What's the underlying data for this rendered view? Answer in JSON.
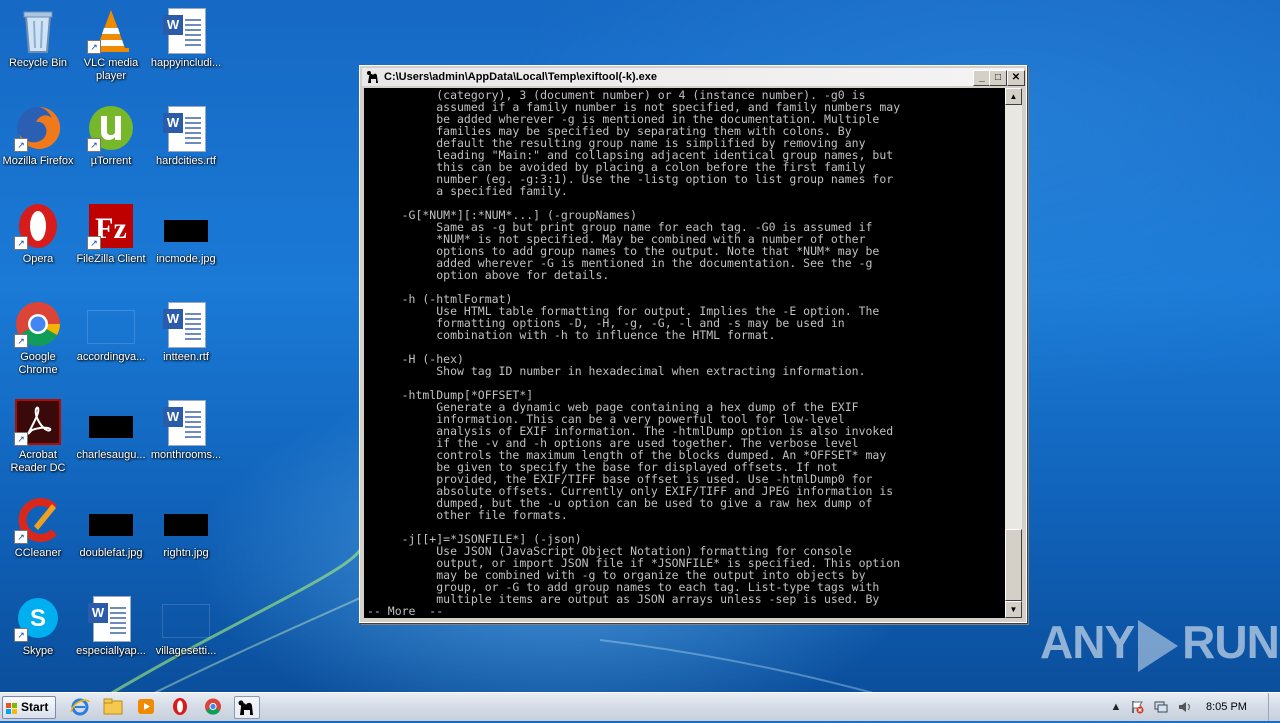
{
  "desktop": {
    "icons": [
      {
        "label": "Recycle Bin"
      },
      {
        "label": "VLC media player"
      },
      {
        "label": "happyincludi..."
      },
      {
        "label": "Mozilla Firefox"
      },
      {
        "label": "µTorrent"
      },
      {
        "label": "hardcities.rtf"
      },
      {
        "label": "Opera"
      },
      {
        "label": "FileZilla Client"
      },
      {
        "label": "incmode.jpg"
      },
      {
        "label": "Google Chrome"
      },
      {
        "label": "accordingva..."
      },
      {
        "label": "intteen.rtf"
      },
      {
        "label": "Acrobat Reader DC"
      },
      {
        "label": "charlesaugu..."
      },
      {
        "label": "monthrooms..."
      },
      {
        "label": "CCleaner"
      },
      {
        "label": "doublefat.jpg"
      },
      {
        "label": "rightn.jpg"
      },
      {
        "label": "Skype"
      },
      {
        "label": "especiallyap..."
      },
      {
        "label": "villagesetti..."
      }
    ]
  },
  "console_window": {
    "title": "C:\\Users\\admin\\AppData\\Local\\Temp\\exiftool(-k).exe",
    "lines": [
      "          (category), 3 (document number) or 4 (instance number). -g0 is",
      "          assumed if a family number is not specified, and family numbers may",
      "          be added wherever -g is mentioned in the documentation. Multiple",
      "          families may be specified by separating them with colons. By",
      "          default the resulting group name is simplified by removing any",
      "          leading \"Main:\" and collapsing adjacent identical group names, but",
      "          this can be avoided by placing a colon before the first family",
      "          number (eg. -g:3:1). Use the -listg option to list group names for",
      "          a specified family.",
      "",
      "     -G[*NUM*][:*NUM*...] (-groupNames)",
      "          Same as -g but print group name for each tag. -G0 is assumed if",
      "          *NUM* is not specified. May be combined with a number of other",
      "          options to add group names to the output. Note that *NUM* may be",
      "          added wherever -G is mentioned in the documentation. See the -g",
      "          option above for details.",
      "",
      "     -h (-htmlFormat)",
      "          Use HTML table formatting for output. Implies the -E option. The",
      "          formatting options -D, -H, -g, -G, -l and -s may be used in",
      "          combination with -h to influence the HTML format.",
      "",
      "     -H (-hex)",
      "          Show tag ID number in hexadecimal when extracting information.",
      "",
      "     -htmlDump[*OFFSET*]",
      "          Generate a dynamic web page containing a hex dump of the EXIF",
      "          information. This can be a very powerful tool for low-level",
      "          analysis of EXIF information. The -htmlDump option is also invoked",
      "          if the -v and -h options are used together. The verbose level",
      "          controls the maximum length of the blocks dumped. An *OFFSET* may",
      "          be given to specify the base for displayed offsets. If not",
      "          provided, the EXIF/TIFF base offset is used. Use -htmlDump0 for",
      "          absolute offsets. Currently only EXIF/TIFF and JPEG information is",
      "          dumped, but the -u option can be used to give a raw hex dump of",
      "          other file formats.",
      "",
      "     -j[[+]=*JSONFILE*] (-json)",
      "          Use JSON (JavaScript Object Notation) formatting for console",
      "          output, or import JSON file if *JSONFILE* is specified. This option",
      "          may be combined with -g to organize the output into objects by",
      "          group, or -G to add group names to each tag. List-type tags with",
      "          multiple items are output as JSON arrays unless -sep is used. By",
      "-- More  --"
    ]
  },
  "watermark": {
    "left": "ANY",
    "right": "RUN"
  },
  "taskbar": {
    "start_label": "Start",
    "clock": "8:05 PM"
  }
}
